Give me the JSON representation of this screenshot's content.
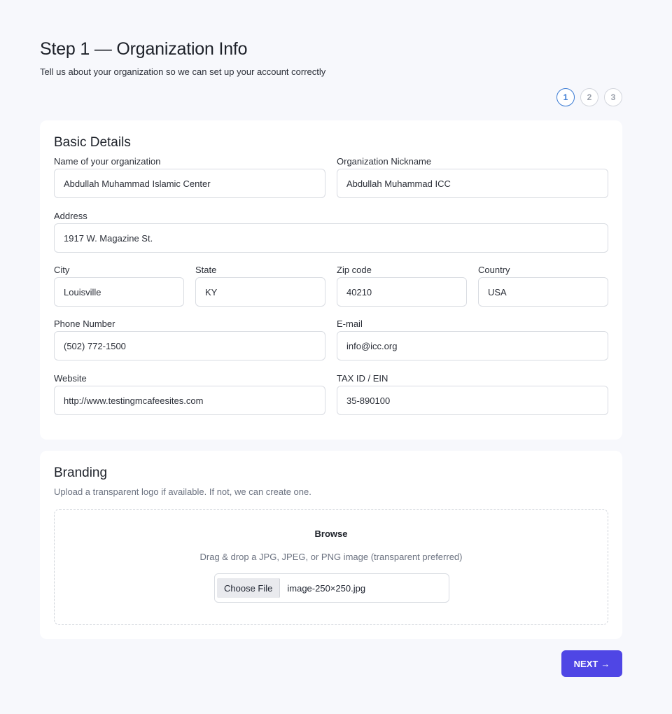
{
  "header": {
    "title": "Step 1 — Organization Info",
    "subtitle": "Tell us about your organization so we can set up your account correctly"
  },
  "stepper": {
    "steps": [
      "1",
      "2",
      "3"
    ],
    "active_step": 1,
    "accent_color": "#3b7bd4"
  },
  "basic_details": {
    "title": "Basic Details",
    "org_name": {
      "label": "Name of your organization",
      "value": "Abdullah Muhammad Islamic Center"
    },
    "nickname": {
      "label": "Organization Nickname",
      "value": "Abdullah Muhammad ICC"
    },
    "address": {
      "label": "Address",
      "value": "1917 W. Magazine St."
    },
    "city": {
      "label": "City",
      "value": "Louisville"
    },
    "state": {
      "label": "State",
      "value": "KY"
    },
    "zip": {
      "label": "Zip code",
      "value": "40210"
    },
    "country": {
      "label": "Country",
      "value": "USA"
    },
    "phone": {
      "label": "Phone Number",
      "value": "(502) 772-1500"
    },
    "email": {
      "label": "E-mail",
      "value": "info@icc.org"
    },
    "website": {
      "label": "Website",
      "value": "http://www.testingmcafeesites.com"
    },
    "tax_id": {
      "label": "TAX ID / EIN",
      "value": "35-890100"
    }
  },
  "branding": {
    "title": "Branding",
    "description": "Upload a transparent logo if available. If not, we can create one.",
    "browse_label": "Browse",
    "drop_hint": "Drag & drop a JPG, JPEG, or PNG image (transparent preferred)",
    "choose_file_label": "Choose File",
    "file_name": "image-250×250.jpg"
  },
  "footer": {
    "next_label": "NEXT",
    "next_icon": "arrow-right-icon",
    "next_color": "#4f46e5"
  }
}
